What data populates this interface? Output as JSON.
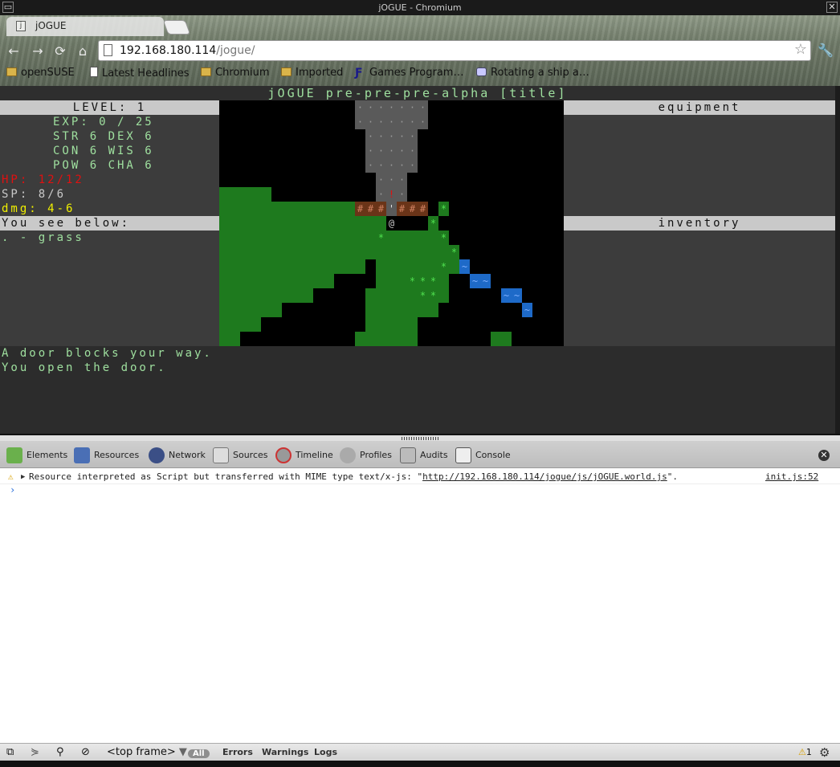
{
  "window": {
    "title": "jOGUE - Chromium"
  },
  "browser": {
    "tab_title": "jOGUE",
    "url_host": "192.168.180.114",
    "url_path": "/jogue/",
    "bookmarks": [
      {
        "label": "openSUSE",
        "icon": "folder-icon"
      },
      {
        "label": "Latest Headlines",
        "icon": "page-icon"
      },
      {
        "label": "Chromium",
        "icon": "folder-icon"
      },
      {
        "label": "Imported",
        "icon": "folder-icon"
      },
      {
        "label": "Games Program…",
        "icon": "gp-icon"
      },
      {
        "label": "Rotating a ship a…",
        "icon": "gamepad-icon"
      }
    ]
  },
  "game": {
    "title": "jOGUE pre-pre-pre-alpha [title]",
    "level": "LEVEL: 1",
    "exp": "EXP: 0 / 25",
    "str_dex": "STR 6 DEX 6",
    "con_wis": "CON 6 WIS 6",
    "pow_cha": "POW 6 CHA 6",
    "hp": "HP: 12/12",
    "sp": "SP: 8/6",
    "dmg": "dmg: 4-6",
    "see_below_header": "You see below:",
    "see_below_item": ". - grass",
    "equipment_header": "equipment",
    "inventory_header": "inventory",
    "messages": [
      "A door blocks your way.",
      "You open the door."
    ],
    "colors": {
      "text": "#9fe09f",
      "hp": "#e01010",
      "dmg": "#f0f000",
      "grass": "#1e7a1e",
      "stone": "#5a5a5a",
      "water": "#1e6ac8",
      "door": "#6a3418"
    }
  },
  "devtools": {
    "tabs": [
      "Elements",
      "Resources",
      "Network",
      "Sources",
      "Timeline",
      "Profiles",
      "Audits",
      "Console"
    ],
    "warning_text_before": "Resource interpreted as Script but transferred with MIME type text/x-js: \"",
    "warning_link": "http://192.168.180.114/jogue/js/jOGUE.world.js",
    "warning_text_after": "\".",
    "warning_source": "init.js:52",
    "prompt": "›",
    "frame_select": "<top frame>",
    "filters": [
      "All",
      "Errors",
      "Warnings",
      "Logs"
    ],
    "warning_count": "1"
  }
}
